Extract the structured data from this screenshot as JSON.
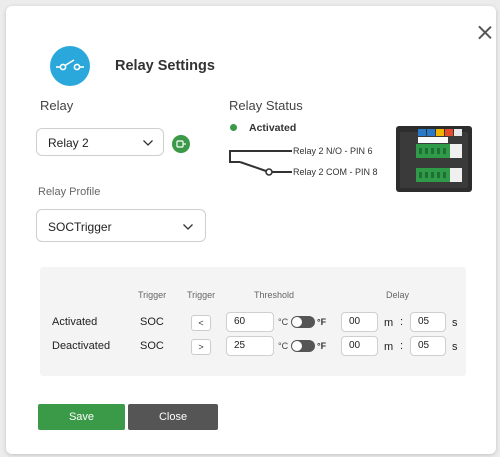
{
  "dialog": {
    "title": "Relay Settings",
    "close_icon": "close-icon"
  },
  "relay": {
    "label": "Relay",
    "selected": "Relay 2",
    "profile_label": "Relay Profile",
    "profile_selected": "SOCTrigger"
  },
  "status": {
    "label": "Relay Status",
    "state": "Activated",
    "state_color": "#3a9a47",
    "pin_no": "Relay 2 N/O - PIN 6",
    "pin_com": "Relay 2 COM - PIN 8"
  },
  "table": {
    "headers": {
      "trigger1": "Trigger",
      "trigger2": "Trigger",
      "threshold": "Threshold",
      "delay": "Delay"
    },
    "rows": [
      {
        "label": "Activated",
        "trigger": "SOC",
        "comparator": "<",
        "threshold": "60",
        "unit_c": "°C",
        "unit_f": "°F",
        "delay_m": "00",
        "m": "m",
        "colon": ":",
        "delay_s": "05",
        "s": "s"
      },
      {
        "label": "Deactivated",
        "trigger": "SOC",
        "comparator": ">",
        "threshold": "25",
        "unit_c": "°C",
        "unit_f": "°F",
        "delay_m": "00",
        "m": "m",
        "colon": ":",
        "delay_s": "05",
        "s": "s"
      }
    ]
  },
  "buttons": {
    "save": "Save",
    "close": "Close"
  },
  "colors": {
    "accent": "#2aa8dc",
    "primary": "#3a9a47",
    "secondary": "#555555"
  }
}
